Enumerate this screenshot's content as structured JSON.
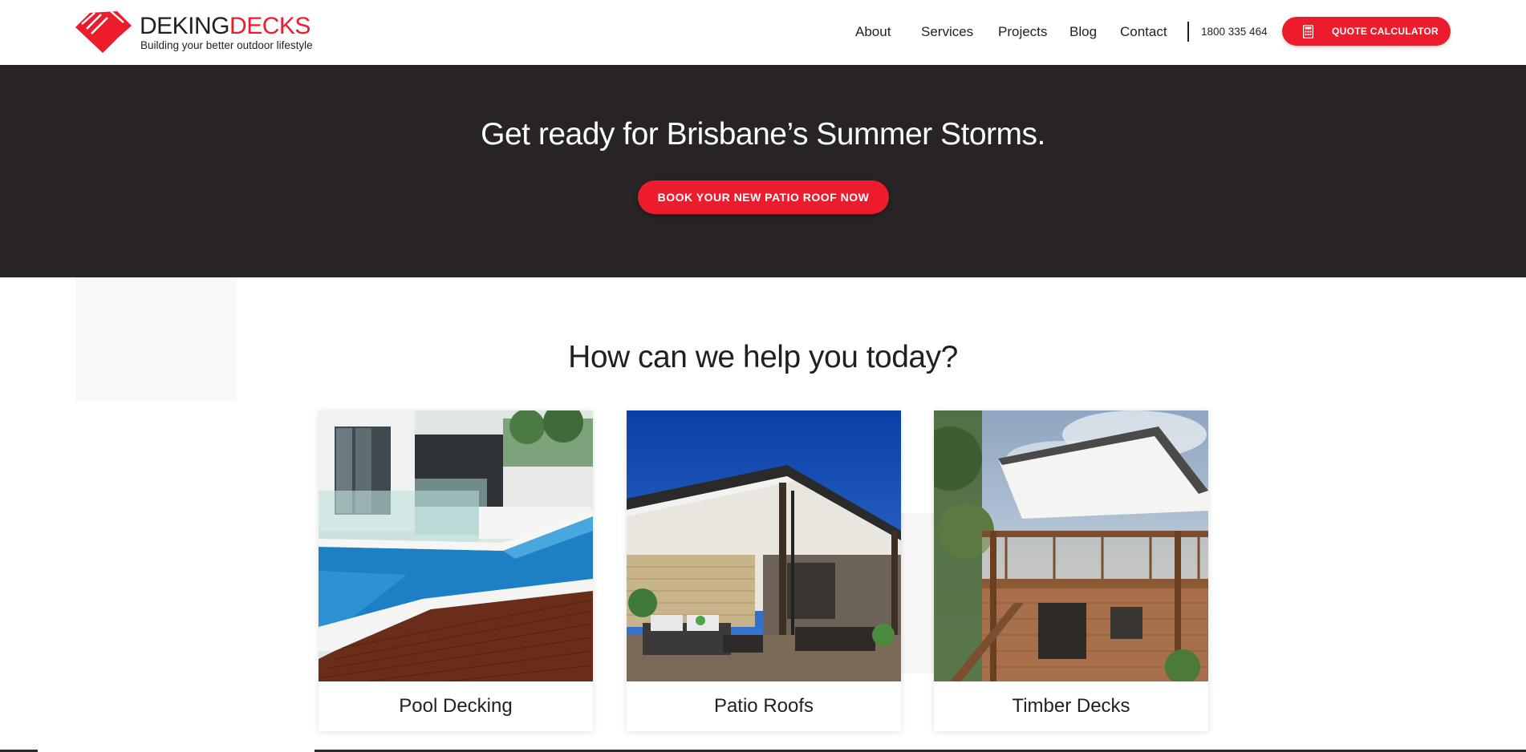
{
  "brand": {
    "name_part1": "DEKING",
    "name_part2": "DECKS",
    "tagline": "Building your better outdoor lifestyle",
    "red": "#ec1c2d",
    "dark": "#231f20"
  },
  "nav": {
    "items": [
      {
        "label": "About"
      },
      {
        "label": "Services"
      },
      {
        "label": "Projects"
      },
      {
        "label": "Blog"
      },
      {
        "label": "Contact"
      }
    ],
    "phone": "1800 335 464",
    "quote_button": {
      "label": "QUOTE CALCULATOR",
      "icon": "calculator-icon"
    }
  },
  "hero": {
    "title": "Get ready for Brisbane’s Summer Storms.",
    "button_label": "BOOK YOUR NEW PATIO ROOF NOW",
    "background": "#282324"
  },
  "services": {
    "heading": "How can we help you today?",
    "cards": [
      {
        "label": "Pool Decking",
        "image": "pool-decking-photo"
      },
      {
        "label": "Patio Roofs",
        "image": "patio-roof-photo"
      },
      {
        "label": "Timber Decks",
        "image": "timber-deck-photo"
      }
    ]
  }
}
